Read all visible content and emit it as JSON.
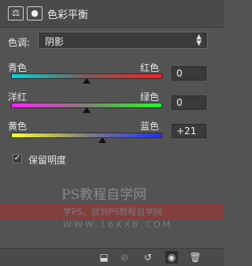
{
  "header": {
    "title": "色彩平衡",
    "icon_balance": "⚖",
    "icon_mask": "●"
  },
  "tone": {
    "label": "色调:",
    "value": "阴影",
    "arrow_up": "▲",
    "arrow_down": "▼"
  },
  "sliders": [
    {
      "left": "青色",
      "right": "红色",
      "value": "0",
      "level": 0.5
    },
    {
      "left": "洋红",
      "right": "绿色",
      "value": "0",
      "level": 0.5
    },
    {
      "left": "黄色",
      "right": "蓝色",
      "value": "+21",
      "level": 0.605
    }
  ],
  "preserve": {
    "label": "保留明度",
    "checked": true,
    "check_mark": "✓"
  },
  "watermark": {
    "line1": "PS教程自学网",
    "line2": "学PS，就到PS教程自学网",
    "line3": "WWW.16XX8.COM"
  },
  "footer": {
    "clip_icon": "⬓",
    "link_icon": "⊘",
    "reset_icon": "↺",
    "eye_icon": "◉",
    "trash_icon": "🗑"
  }
}
